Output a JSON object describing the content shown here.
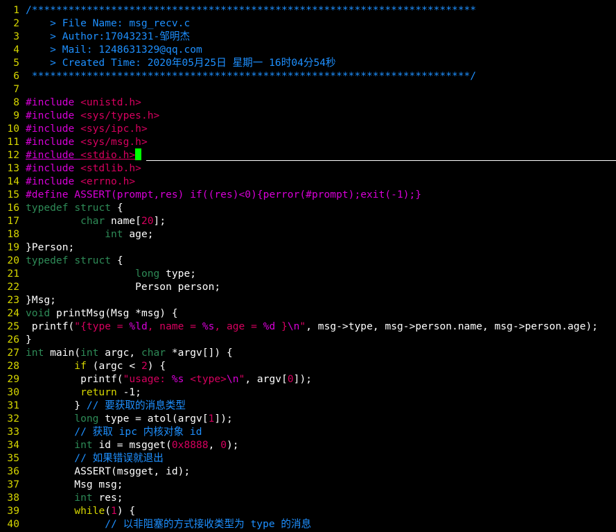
{
  "editor": {
    "cursor_line": 12,
    "colors": {
      "background": "#000000",
      "line_number": "#d7d700",
      "comment": "#1e90ff",
      "preproc": "#d700d7",
      "include_path": "#d7005f",
      "type": "#2e8b57",
      "keyword": "#d7d700",
      "string": "#d7005f",
      "number": "#d7005f",
      "format": "#d700d7",
      "cursor": "#00ff00"
    },
    "lines": [
      {
        "n": "1",
        "tokens": [
          {
            "t": "comment",
            "s": "/*************************************************************************"
          }
        ]
      },
      {
        "n": "2",
        "tokens": [
          {
            "t": "comment",
            "s": "    > File Name: msg_recv.c"
          }
        ]
      },
      {
        "n": "3",
        "tokens": [
          {
            "t": "comment",
            "s": "    > Author:17043231-邹明杰"
          }
        ]
      },
      {
        "n": "4",
        "tokens": [
          {
            "t": "comment",
            "s": "    > Mail: 1248631329@qq.com"
          }
        ]
      },
      {
        "n": "5",
        "tokens": [
          {
            "t": "comment",
            "s": "    > Created Time: 2020年05月25日 星期一 16时04分54秒"
          }
        ]
      },
      {
        "n": "6",
        "tokens": [
          {
            "t": "comment",
            "s": " ************************************************************************/"
          }
        ]
      },
      {
        "n": "7",
        "tokens": []
      },
      {
        "n": "8",
        "tokens": [
          {
            "t": "pre",
            "s": "#include "
          },
          {
            "t": "inc",
            "s": "<unistd.h>"
          }
        ]
      },
      {
        "n": "9",
        "tokens": [
          {
            "t": "pre",
            "s": "#include "
          },
          {
            "t": "inc",
            "s": "<sys/types.h>"
          }
        ]
      },
      {
        "n": "10",
        "tokens": [
          {
            "t": "pre",
            "s": "#include "
          },
          {
            "t": "inc",
            "s": "<sys/ipc.h>"
          }
        ]
      },
      {
        "n": "11",
        "tokens": [
          {
            "t": "pre",
            "s": "#include "
          },
          {
            "t": "inc",
            "s": "<sys/msg.h>"
          }
        ]
      },
      {
        "n": "12",
        "tokens": [
          {
            "t": "pre",
            "s": "#include "
          },
          {
            "t": "inc",
            "s": "<stdio.h>"
          }
        ]
      },
      {
        "n": "13",
        "tokens": [
          {
            "t": "pre",
            "s": "#include "
          },
          {
            "t": "inc",
            "s": "<stdlib.h>"
          }
        ]
      },
      {
        "n": "14",
        "tokens": [
          {
            "t": "pre",
            "s": "#include "
          },
          {
            "t": "inc",
            "s": "<errno.h>"
          }
        ]
      },
      {
        "n": "15",
        "tokens": [
          {
            "t": "pre",
            "s": "#define ASSERT(prompt,res) if((res)<0){perror(#prompt);exit(-1);}"
          }
        ]
      },
      {
        "n": "16",
        "tokens": [
          {
            "t": "type",
            "s": "typedef"
          },
          {
            "t": "plain",
            "s": " "
          },
          {
            "t": "type",
            "s": "struct"
          },
          {
            "t": "plain",
            "s": " {"
          }
        ]
      },
      {
        "n": "17",
        "tokens": [
          {
            "t": "plain",
            "s": "         "
          },
          {
            "t": "type",
            "s": "char"
          },
          {
            "t": "plain",
            "s": " name["
          },
          {
            "t": "num",
            "s": "20"
          },
          {
            "t": "plain",
            "s": "];"
          }
        ]
      },
      {
        "n": "18",
        "tokens": [
          {
            "t": "plain",
            "s": "             "
          },
          {
            "t": "type",
            "s": "int"
          },
          {
            "t": "plain",
            "s": " age;"
          }
        ]
      },
      {
        "n": "19",
        "tokens": [
          {
            "t": "plain",
            "s": "}Person;"
          }
        ]
      },
      {
        "n": "20",
        "tokens": [
          {
            "t": "type",
            "s": "typedef"
          },
          {
            "t": "plain",
            "s": " "
          },
          {
            "t": "type",
            "s": "struct"
          },
          {
            "t": "plain",
            "s": " {"
          }
        ]
      },
      {
        "n": "21",
        "tokens": [
          {
            "t": "plain",
            "s": "                  "
          },
          {
            "t": "type",
            "s": "long"
          },
          {
            "t": "plain",
            "s": " type;"
          }
        ]
      },
      {
        "n": "22",
        "tokens": [
          {
            "t": "plain",
            "s": "                  Person person;"
          }
        ]
      },
      {
        "n": "23",
        "tokens": [
          {
            "t": "plain",
            "s": "}Msg;"
          }
        ]
      },
      {
        "n": "24",
        "tokens": [
          {
            "t": "type",
            "s": "void"
          },
          {
            "t": "plain",
            "s": " printMsg(Msg *msg) {"
          }
        ]
      },
      {
        "n": "25",
        "tokens": [
          {
            "t": "plain",
            "s": " printf("
          },
          {
            "t": "str",
            "s": "\"{type = "
          },
          {
            "t": "fmt",
            "s": "%ld"
          },
          {
            "t": "str",
            "s": ", name = "
          },
          {
            "t": "fmt",
            "s": "%s"
          },
          {
            "t": "str",
            "s": ", age = "
          },
          {
            "t": "fmt",
            "s": "%d"
          },
          {
            "t": "str",
            "s": " }"
          },
          {
            "t": "fmt",
            "s": "\\n"
          },
          {
            "t": "str",
            "s": "\""
          },
          {
            "t": "plain",
            "s": ", msg->type, msg->person.name, msg->person.age);"
          }
        ]
      },
      {
        "n": "26",
        "tokens": [
          {
            "t": "plain",
            "s": "}"
          }
        ]
      },
      {
        "n": "27",
        "tokens": [
          {
            "t": "type",
            "s": "int"
          },
          {
            "t": "plain",
            "s": " main("
          },
          {
            "t": "type",
            "s": "int"
          },
          {
            "t": "plain",
            "s": " argc, "
          },
          {
            "t": "type",
            "s": "char"
          },
          {
            "t": "plain",
            "s": " *argv[]) {"
          }
        ]
      },
      {
        "n": "28",
        "tokens": [
          {
            "t": "plain",
            "s": "        "
          },
          {
            "t": "kw",
            "s": "if"
          },
          {
            "t": "plain",
            "s": " (argc < "
          },
          {
            "t": "num",
            "s": "2"
          },
          {
            "t": "plain",
            "s": ") {"
          }
        ]
      },
      {
        "n": "29",
        "tokens": [
          {
            "t": "plain",
            "s": "         printf("
          },
          {
            "t": "str",
            "s": "\"usage: "
          },
          {
            "t": "fmt",
            "s": "%s"
          },
          {
            "t": "str",
            "s": " <type>"
          },
          {
            "t": "fmt",
            "s": "\\n"
          },
          {
            "t": "str",
            "s": "\""
          },
          {
            "t": "plain",
            "s": ", argv["
          },
          {
            "t": "num",
            "s": "0"
          },
          {
            "t": "plain",
            "s": "]);"
          }
        ]
      },
      {
        "n": "30",
        "tokens": [
          {
            "t": "plain",
            "s": "         "
          },
          {
            "t": "kw",
            "s": "return"
          },
          {
            "t": "plain",
            "s": " -1;"
          }
        ]
      },
      {
        "n": "31",
        "tokens": [
          {
            "t": "plain",
            "s": "        } "
          },
          {
            "t": "comment",
            "s": "// 要获取的消息类型"
          }
        ]
      },
      {
        "n": "32",
        "tokens": [
          {
            "t": "plain",
            "s": "        "
          },
          {
            "t": "type",
            "s": "long"
          },
          {
            "t": "plain",
            "s": " type = atol(argv["
          },
          {
            "t": "num",
            "s": "1"
          },
          {
            "t": "plain",
            "s": "]);"
          }
        ]
      },
      {
        "n": "33",
        "tokens": [
          {
            "t": "plain",
            "s": "        "
          },
          {
            "t": "comment",
            "s": "// 获取 ipc 内核对象 id"
          }
        ]
      },
      {
        "n": "34",
        "tokens": [
          {
            "t": "plain",
            "s": "        "
          },
          {
            "t": "type",
            "s": "int"
          },
          {
            "t": "plain",
            "s": " id = msgget("
          },
          {
            "t": "num",
            "s": "0x8888"
          },
          {
            "t": "plain",
            "s": ", "
          },
          {
            "t": "num",
            "s": "0"
          },
          {
            "t": "plain",
            "s": ");"
          }
        ]
      },
      {
        "n": "35",
        "tokens": [
          {
            "t": "plain",
            "s": "        "
          },
          {
            "t": "comment",
            "s": "// 如果错误就退出"
          }
        ]
      },
      {
        "n": "36",
        "tokens": [
          {
            "t": "plain",
            "s": "        ASSERT(msgget, id);"
          }
        ]
      },
      {
        "n": "37",
        "tokens": [
          {
            "t": "plain",
            "s": "        Msg msg;"
          }
        ]
      },
      {
        "n": "38",
        "tokens": [
          {
            "t": "plain",
            "s": "        "
          },
          {
            "t": "type",
            "s": "int"
          },
          {
            "t": "plain",
            "s": " res;"
          }
        ]
      },
      {
        "n": "39",
        "tokens": [
          {
            "t": "plain",
            "s": "        "
          },
          {
            "t": "kw",
            "s": "while"
          },
          {
            "t": "plain",
            "s": "("
          },
          {
            "t": "num",
            "s": "1"
          },
          {
            "t": "plain",
            "s": ") {"
          }
        ]
      },
      {
        "n": "40",
        "tokens": [
          {
            "t": "plain",
            "s": "             "
          },
          {
            "t": "comment",
            "s": "// 以非阻塞的方式接收类型为 type 的消息"
          }
        ]
      }
    ]
  }
}
